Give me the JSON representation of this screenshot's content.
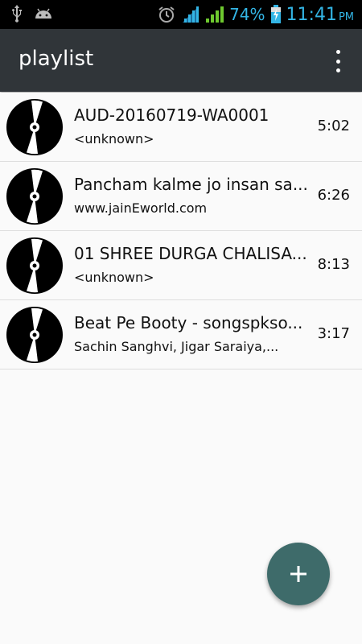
{
  "status_bar": {
    "left_icons": [
      "usb-icon",
      "android-icon"
    ],
    "right_icons": [
      "alarm-icon",
      "wifi-signal-icon",
      "cell-signal-icon",
      "battery-charging-icon"
    ],
    "battery_percent": "74%",
    "time": "11:41",
    "ampm": "PM",
    "accent_color": "#33b5e5"
  },
  "app_bar": {
    "title": "playlist",
    "overflow_icon": "more-vert-icon",
    "background": "#303539"
  },
  "tracks": [
    {
      "title": "AUD-20160719-WA0001",
      "artist": "<unknown>",
      "duration": "5:02",
      "icon": "disc-icon"
    },
    {
      "title": "Pancham kalme jo insan sa...",
      "artist": "www.jainEworld.com",
      "duration": "6:26",
      "icon": "disc-icon"
    },
    {
      "title": "01 SHREE DURGA CHALISA...",
      "artist": "<unknown>",
      "duration": "8:13",
      "icon": "disc-icon"
    },
    {
      "title": "Beat Pe Booty - songspkso...",
      "artist": "Sachin Sanghvi, Jigar Saraiya,...",
      "duration": "3:17",
      "icon": "disc-icon"
    }
  ],
  "fab": {
    "icon": "plus-icon",
    "color": "#3e6b6a"
  }
}
